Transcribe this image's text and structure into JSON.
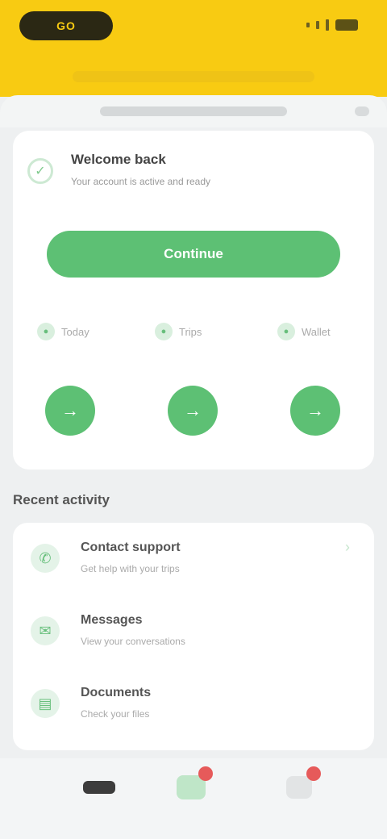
{
  "app": {
    "logo": "GO"
  },
  "card": {
    "title": "Welcome back",
    "subtitle": "Your account is active and ready",
    "main_button": "Continue"
  },
  "stats": [
    {
      "icon": "clock-icon",
      "label": "Today"
    },
    {
      "icon": "route-icon",
      "label": "Trips"
    },
    {
      "icon": "wallet-icon",
      "label": "Wallet"
    }
  ],
  "section": {
    "title": "Recent activity"
  },
  "list": [
    {
      "icon": "phone-icon",
      "title": "Contact support",
      "desc": "Get help with your trips"
    },
    {
      "icon": "chat-icon",
      "title": "Messages",
      "desc": "View your conversations"
    },
    {
      "icon": "doc-icon",
      "title": "Documents",
      "desc": "Check your files"
    }
  ],
  "colors": {
    "brand": "#f8cb12",
    "accent": "#5dc074",
    "badge": "#e65a5a"
  }
}
